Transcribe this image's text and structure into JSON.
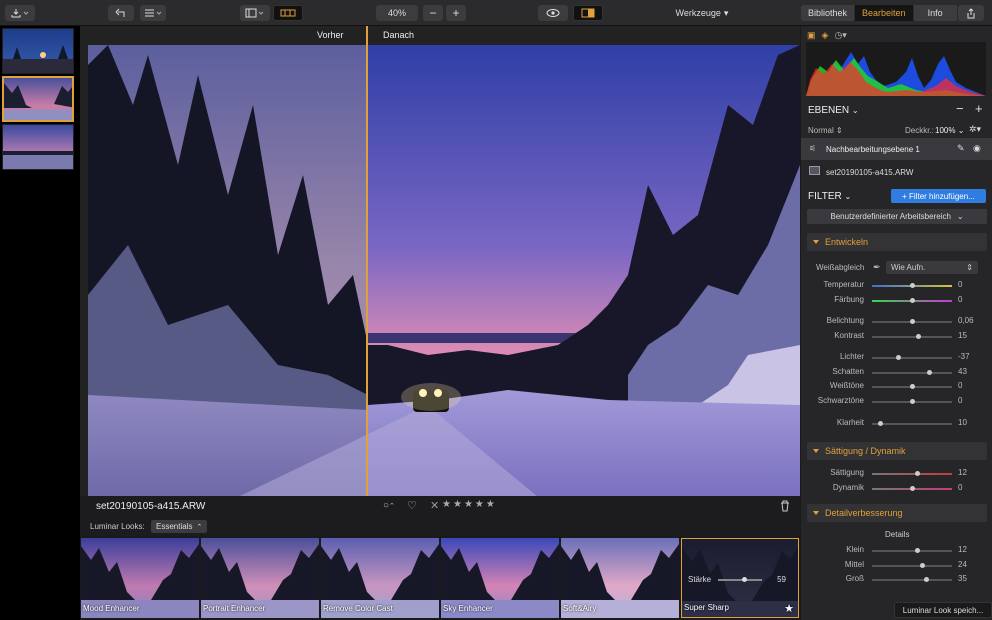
{
  "toolbar": {
    "zoom": "40%",
    "minus": "−",
    "plus": "+",
    "tools_label": "Werkzeuge",
    "tabs": [
      "Bibliothek",
      "Bearbeiten",
      "Info"
    ],
    "active_tab_index": 1
  },
  "viewer": {
    "before_label": "Vorher",
    "after_label": "Danach",
    "before_fraction": 0.39
  },
  "infobar": {
    "filename": "set20190105-a415.ARW",
    "rating_stars": [
      "★",
      "★",
      "★",
      "★",
      "★"
    ]
  },
  "looks": {
    "label": "Luminar Looks:",
    "collection": "Essentials",
    "items": [
      "Mood Enhancer",
      "Portrait Enhancer",
      "Remove Color Cast",
      "Sky Enhancer",
      "Soft&Airy",
      "Super Sharp"
    ],
    "selected_index": 5,
    "strength_label": "Stärke",
    "strength_value": "59",
    "save_button": "Luminar Look speich..."
  },
  "panel": {
    "layers_title": "EBENEN",
    "blend_mode": "Normal",
    "opacity_label": "Deckkr.:",
    "opacity_value": "100%",
    "layers": [
      {
        "name": "Nachbearbeitungsebene 1"
      },
      {
        "name": "set20190105-a415.ARW"
      }
    ],
    "filter_title": "FILTER",
    "add_filter": "+ Filter hinzufügen...",
    "workspace": "Benutzerdefinierter Arbeitsbereich",
    "develop": {
      "title": "Entwickeln",
      "wb_label": "Weißabgleich",
      "wb_value": "Wie Aufn.",
      "sliders": [
        {
          "label": "Temperatur",
          "value": "0",
          "pos": 0.5,
          "color": "linear-gradient(90deg,#3b6fd4,#d4c43b)"
        },
        {
          "label": "Färbung",
          "value": "0",
          "pos": 0.5,
          "color": "linear-gradient(90deg,#3bd44a,#c43bd4)"
        },
        {
          "label": "Belichtung",
          "value": "0,06",
          "pos": 0.5
        },
        {
          "label": "Kontrast",
          "value": "15",
          "pos": 0.57
        },
        {
          "label": "Lichter",
          "value": "-37",
          "pos": 0.32
        },
        {
          "label": "Schatten",
          "value": "43",
          "pos": 0.71
        },
        {
          "label": "Weißtöne",
          "value": "0",
          "pos": 0.5
        },
        {
          "label": "Schwarztöne",
          "value": "0",
          "pos": 0.5
        },
        {
          "label": "Klarheit",
          "value": "10",
          "pos": 0.1
        }
      ]
    },
    "saturation": {
      "title": "Sättigung / Dynamik",
      "sliders": [
        {
          "label": "Sättigung",
          "value": "12",
          "pos": 0.56,
          "color": "linear-gradient(90deg,#777,#c43b3b)"
        },
        {
          "label": "Dynamik",
          "value": "0",
          "pos": 0.5,
          "color": "linear-gradient(90deg,#777,#c43b7b)"
        }
      ]
    },
    "detail": {
      "title": "Detailverbesserung",
      "sub": "Details",
      "sliders": [
        {
          "label": "Klein",
          "value": "12",
          "pos": 0.56
        },
        {
          "label": "Mittel",
          "value": "24",
          "pos": 0.62
        },
        {
          "label": "Groß",
          "value": "35",
          "pos": 0.67
        }
      ]
    }
  },
  "colors": {
    "accent": "#e0a13a",
    "blue_button": "#2f7de1"
  }
}
